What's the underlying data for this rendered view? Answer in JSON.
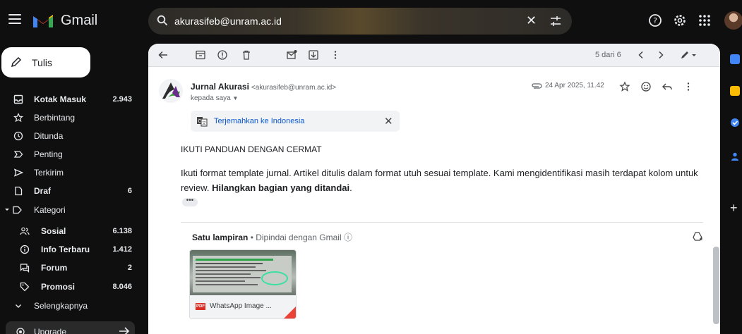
{
  "app": {
    "name": "Gmail"
  },
  "search": {
    "query": "akurasifeb@unram.ac.id"
  },
  "sidebar": {
    "compose_label": "Tulis",
    "items": [
      {
        "label": "Kotak Masuk",
        "count": "2.943",
        "bold": true,
        "icon": "inbox-icon"
      },
      {
        "label": "Berbintang",
        "count": "",
        "bold": false,
        "icon": "star-icon"
      },
      {
        "label": "Ditunda",
        "count": "",
        "bold": false,
        "icon": "clock-icon"
      },
      {
        "label": "Penting",
        "count": "",
        "bold": false,
        "icon": "important-icon"
      },
      {
        "label": "Terkirim",
        "count": "",
        "bold": false,
        "icon": "send-icon"
      },
      {
        "label": "Draf",
        "count": "6",
        "bold": true,
        "icon": "draft-icon"
      },
      {
        "label": "Kategori",
        "count": "",
        "bold": false,
        "icon": "label-icon"
      },
      {
        "label": "Sosial",
        "count": "6.138",
        "bold": true,
        "icon": "people-icon"
      },
      {
        "label": "Info Terbaru",
        "count": "1.412",
        "bold": true,
        "icon": "info-icon"
      },
      {
        "label": "Forum",
        "count": "2",
        "bold": true,
        "icon": "forum-icon"
      },
      {
        "label": "Promosi",
        "count": "8.046",
        "bold": true,
        "icon": "tag-icon"
      },
      {
        "label": "Selengkapnya",
        "count": "",
        "bold": false,
        "icon": "chevron-down-icon"
      }
    ],
    "upgrade_label": "Upgrade"
  },
  "toolbar": {
    "pager": "5 dari 6"
  },
  "email": {
    "sender_name": "Jurnal Akurasi",
    "sender_email": "<akurasifeb@unram.ac.id>",
    "to_me": "kepada saya",
    "date": "24 Apr 2025, 11.42",
    "translate_label": "Terjemahkan ke Indonesia",
    "heading": "IKUTI PANDUAN DENGAN CERMAT",
    "body_plain": "Ikuti format template jurnal. Artikel ditulis dalam format utuh sesuai template.  Kami mengidentifikasi masih terdapat kolom untuk review. ",
    "body_bold": "Hilangkan bagian yang ditandai",
    "body_end": ".",
    "more": "•••"
  },
  "attachments": {
    "title": "Satu lampiran",
    "scanned": " • Dipindai dengan Gmail ⓘ",
    "file_name": "WhatsApp Image ...",
    "file_type": "PDF"
  },
  "colors": {
    "accent": "#0b57d0",
    "panel": "#ffffff",
    "background": "#0f0f0f",
    "pdf": "#d93025"
  }
}
